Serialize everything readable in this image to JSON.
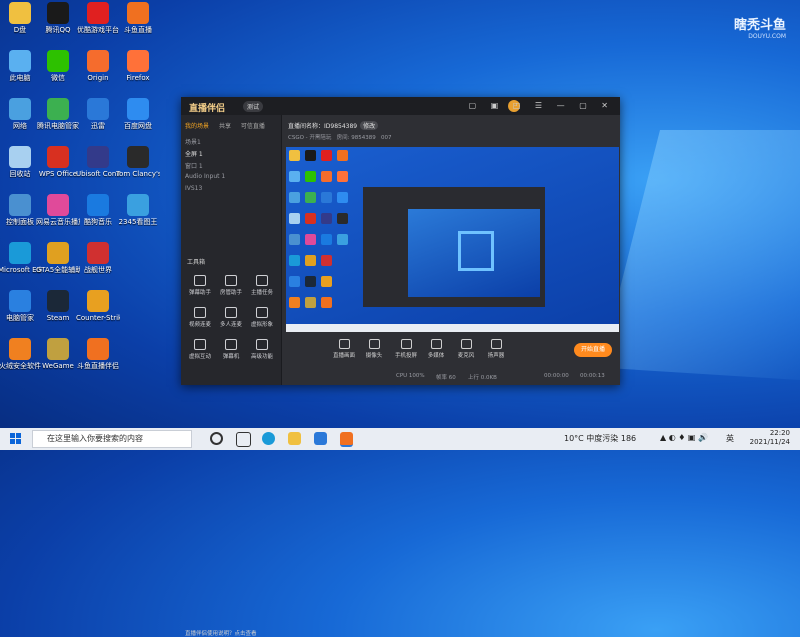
{
  "watermark": {
    "brand": "瞎秃斗鱼",
    "site": "DOUYU.COM"
  },
  "desktop_icons": [
    {
      "label": "D盘",
      "icon": "folder-icon",
      "color": "#f0c040"
    },
    {
      "label": "腾讯QQ",
      "icon": "qq-icon",
      "color": "#1a1a1a"
    },
    {
      "label": "优酷游戏平台",
      "icon": "game-platform-icon",
      "color": "#e02020"
    },
    {
      "label": "斗鱼直播",
      "icon": "douyu-icon",
      "color": "#f07020"
    },
    {
      "label": "此电脑",
      "icon": "computer-icon",
      "color": "#5ab0f0"
    },
    {
      "label": "微信",
      "icon": "wechat-icon",
      "color": "#2dc100"
    },
    {
      "label": "Origin",
      "icon": "origin-icon",
      "color": "#f56c2d"
    },
    {
      "label": "Firefox",
      "icon": "firefox-icon",
      "color": "#ff7139"
    },
    {
      "label": "网络",
      "icon": "network-icon",
      "color": "#4aa0e0"
    },
    {
      "label": "腾讯电脑管家",
      "icon": "pc-manager-icon",
      "color": "#3cb050"
    },
    {
      "label": "迅雷",
      "icon": "thunder-icon",
      "color": "#2a78d8"
    },
    {
      "label": "百度网盘",
      "icon": "baidu-netdisk-icon",
      "color": "#2e8cf0"
    },
    {
      "label": "回收站",
      "icon": "recycle-bin-icon",
      "color": "#a8d0f0"
    },
    {
      "label": "WPS Office",
      "icon": "wps-icon",
      "color": "#d83020"
    },
    {
      "label": "Ubisoft Connect",
      "icon": "ubisoft-icon",
      "color": "#333a8a"
    },
    {
      "label": "Tom Clancy's R...",
      "icon": "rainbow-six-icon",
      "color": "#2a2a2a"
    },
    {
      "label": "控制面板",
      "icon": "control-panel-icon",
      "color": "#4a90d0"
    },
    {
      "label": "网易云音乐播放器",
      "icon": "music-icon",
      "color": "#e04a9a"
    },
    {
      "label": "酷狗音乐",
      "icon": "kugou-icon",
      "color": "#1a7ae0"
    },
    {
      "label": "2345看图王",
      "icon": "photo-viewer-icon",
      "color": "#3aa0e0"
    },
    {
      "label": "Microsoft Edge",
      "icon": "edge-icon",
      "color": "#1a9ad8"
    },
    {
      "label": "GTA5全能辅助工具",
      "icon": "gta-tool-icon",
      "color": "#e0a020"
    },
    {
      "label": "战舰世界",
      "icon": "game-icon",
      "color": "#d03030"
    },
    {
      "label": "",
      "icon": "blank-icon",
      "color": "transparent"
    },
    {
      "label": "电脑管家",
      "icon": "shield-icon",
      "color": "#2a80e0"
    },
    {
      "label": "Steam",
      "icon": "steam-icon",
      "color": "#1b2838"
    },
    {
      "label": "Counter-Strike Global Offensive",
      "icon": "csgo-icon",
      "color": "#e8a020"
    },
    {
      "label": "",
      "icon": "blank-icon",
      "color": "transparent"
    },
    {
      "label": "火绒安全软件",
      "icon": "huorong-icon",
      "color": "#f08020"
    },
    {
      "label": "WeGame",
      "icon": "wegame-icon",
      "color": "#c0a040"
    },
    {
      "label": "斗鱼直播伴侣",
      "icon": "douyu-companion-icon",
      "color": "#f07020"
    }
  ],
  "app": {
    "logo": "直播伴侣",
    "version": "测试",
    "sidebar_tabs": [
      "我的场景",
      "共享",
      "可信直播"
    ],
    "scenes": [
      "场景1",
      "全屏 1",
      "窗口 1",
      "Audio Input 1",
      "IVS13"
    ],
    "tools_title": "工具箱",
    "tools": [
      "弹幕助手",
      "房管助手",
      "主播任务",
      "视频连麦",
      "多人连麦",
      "虚拟形象",
      "虚拟互动",
      "弹幕机",
      "高级功能"
    ],
    "room_title": "直播间名称：ID9854389",
    "room_tag": "修改",
    "category": "CSGO - 开黑陪玩",
    "room_no": "房间: 9854389",
    "viewers": "007",
    "controls": [
      "直播画面",
      "摄像头",
      "手机投屏",
      "多媒体",
      "麦克风",
      "扬声器"
    ],
    "go_live": "开始直播",
    "notice": "直播伴侣使用说明？点击查看",
    "status": {
      "cpu": "CPU 100%",
      "fps": "帧率 60",
      "up": "上行 0.0KB",
      "time1": "00:00:00",
      "time2": "00:00:13"
    }
  },
  "taskbar": {
    "search_placeholder": "在这里输入你要搜索的内容",
    "weather": "10°C 中度污染 186",
    "lang": "英",
    "time": "22:20",
    "date": "2021/11/24"
  }
}
